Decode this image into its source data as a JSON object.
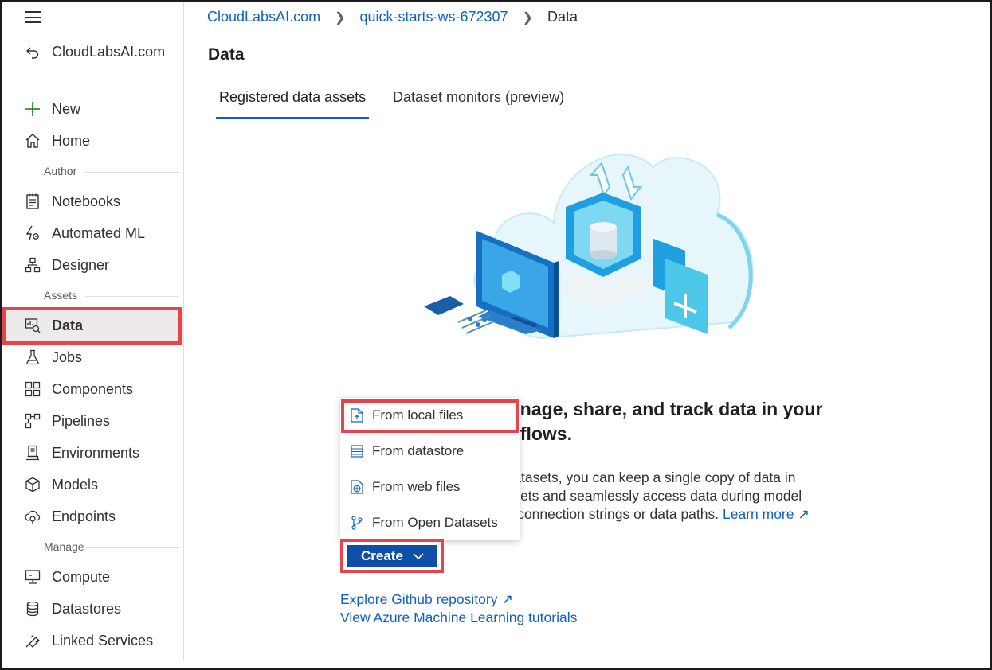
{
  "sidebar": {
    "back_label": "CloudLabsAI.com",
    "items_top": [
      {
        "label": "New"
      },
      {
        "label": "Home"
      }
    ],
    "section_author": "Author",
    "items_author": [
      {
        "label": "Notebooks"
      },
      {
        "label": "Automated ML"
      },
      {
        "label": "Designer"
      }
    ],
    "section_assets": "Assets",
    "items_assets": [
      {
        "label": "Data"
      },
      {
        "label": "Jobs"
      },
      {
        "label": "Components"
      },
      {
        "label": "Pipelines"
      },
      {
        "label": "Environments"
      },
      {
        "label": "Models"
      },
      {
        "label": "Endpoints"
      }
    ],
    "section_manage": "Manage",
    "items_manage": [
      {
        "label": "Compute"
      },
      {
        "label": "Datastores"
      },
      {
        "label": "Linked Services"
      }
    ]
  },
  "breadcrumb": {
    "items": [
      "CloudLabsAI.com",
      "quick-starts-ws-672307",
      "Data"
    ]
  },
  "page": {
    "title": "Data",
    "tabs": [
      {
        "label": "Registered data assets",
        "active": true
      },
      {
        "label": "Dataset monitors (preview)",
        "active": false
      }
    ],
    "heading_line1": "anage, share, and track data in your",
    "heading_line2": "kflows.",
    "desc_line1": "g datasets, you can keep a single copy of data in",
    "desc_line2": "atasets and seamlessly access data during model",
    "desc_line3": "out connection strings or data paths.",
    "learn_more": "Learn more",
    "create_label": "Create",
    "explore_link": "Explore Github repository",
    "tutorials_link": "View Azure Machine Learning tutorials"
  },
  "dropdown": {
    "items": [
      {
        "label": "From local files",
        "icon": "file-upload-icon"
      },
      {
        "label": "From datastore",
        "icon": "table-icon"
      },
      {
        "label": "From web files",
        "icon": "web-file-icon"
      },
      {
        "label": "From Open Datasets",
        "icon": "branch-icon"
      }
    ]
  },
  "colors": {
    "link": "#0f62c4",
    "primary_button": "#0f4fa8",
    "highlight_red": "#e8424a",
    "selected_bg": "#edebe9"
  }
}
